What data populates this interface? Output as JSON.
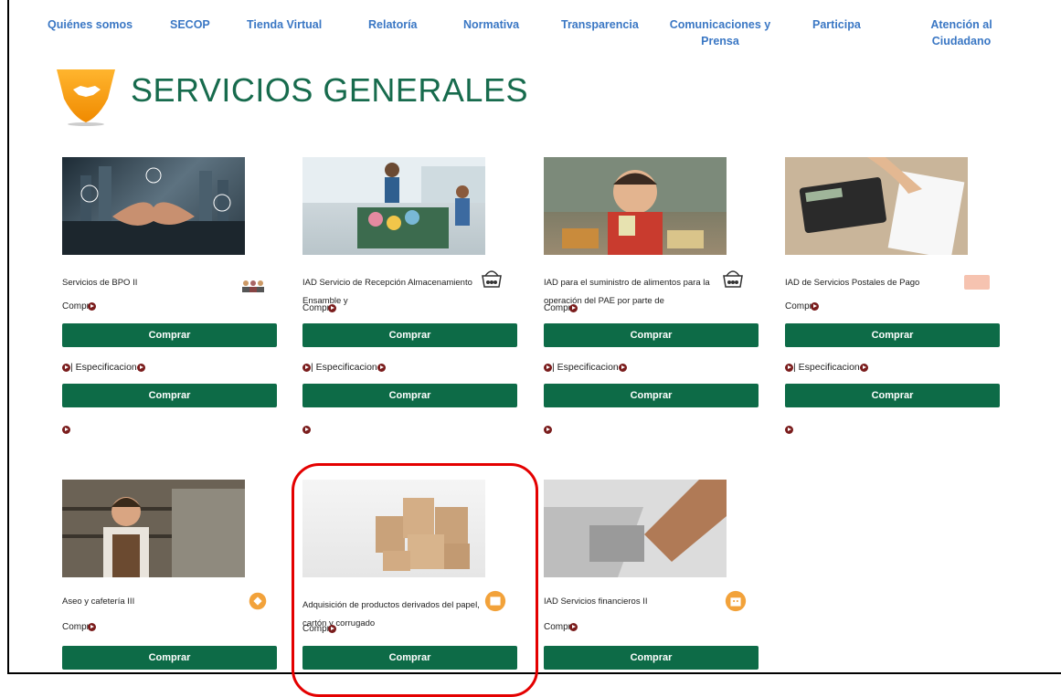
{
  "nav": [
    {
      "label": "Quiénes somos"
    },
    {
      "label": "SECOP"
    },
    {
      "label": "Tienda Virtual"
    },
    {
      "label": "Relatoría"
    },
    {
      "label": "Normativa"
    },
    {
      "label": "Transparencia"
    },
    {
      "label": "Comunicaciones y Prensa"
    },
    {
      "label": "Participa"
    },
    {
      "label": "Atención al Ciudadano"
    }
  ],
  "section_title": "SERVICIOS GENERALES",
  "cards": [
    {
      "title": "Servicios de BPO II",
      "comp": "Compr",
      "buy1": "Comprar",
      "spec": "| Especificacion",
      "buy2": "Comprar",
      "icon": "people-icon"
    },
    {
      "title": "IAD Servicio de Recepción Almacenamiento Ensamble y",
      "comp": "Compr",
      "buy1": "Comprar",
      "spec": "| Especificacion",
      "buy2": "Comprar",
      "icon": "food-icon"
    },
    {
      "title": "IAD para el suministro de alimentos para la operación del PAE por parte de",
      "comp": "Compr",
      "buy1": "Comprar",
      "spec": "| Especificacion",
      "buy2": "Comprar",
      "icon": "food-icon"
    },
    {
      "title": "IAD de Servicios Postales de Pago",
      "comp": "Compr",
      "buy1": "Comprar",
      "spec": "| Especificacion",
      "buy2": "Comprar",
      "icon": "postal-icon"
    },
    {
      "title": "Aseo y cafetería III",
      "comp": "Compr",
      "buy1": "Comprar",
      "icon": "cleaning-icon"
    },
    {
      "title": "Adquisición de productos derivados del papel, cartón y corrugado",
      "comp": "Compr",
      "buy1": "Comprar",
      "icon": "box-icon"
    },
    {
      "title": "IAD Servicios financieros II",
      "comp": "Compr",
      "buy1": "Comprar",
      "icon": "bank-icon"
    }
  ]
}
